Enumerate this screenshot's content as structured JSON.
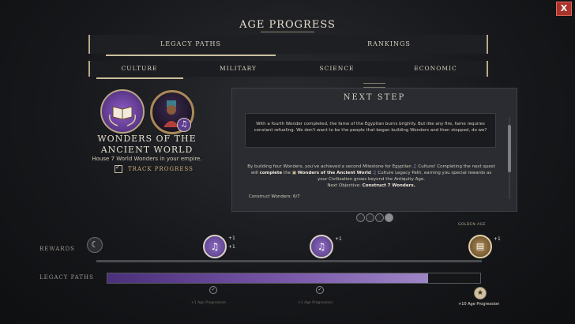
{
  "window": {
    "title": "AGE PROGRESS",
    "close_label": "X"
  },
  "top_tabs": [
    {
      "label": "LEGACY PATHS",
      "selected": true
    },
    {
      "label": "RANKINGS",
      "selected": false
    }
  ],
  "sub_tabs": [
    {
      "label": "CULTURE",
      "selected": true
    },
    {
      "label": "MILITARY",
      "selected": false
    },
    {
      "label": "SCIENCE",
      "selected": false
    },
    {
      "label": "ECONOMIC",
      "selected": false
    }
  ],
  "legacy_path": {
    "name": "WONDERS OF THE ANCIENT WORLD",
    "description": "House 7 World Wonders in your empire.",
    "track_label": "TRACK PROGRESS",
    "tracking": true,
    "icons": [
      "book-laurel-icon",
      "leader-portrait",
      "music-note-icon"
    ]
  },
  "next_step": {
    "heading": "NEXT STEP",
    "quote": "With a fourth Wonder completed, the fame of the Egyptian burns brightly. But like any fire, fame requires constant refueling. We don't want to be the people that began building Wonders and then stopped, do we?",
    "body_1": "By building four Wonders, you've achieved a second Milestone for Egyptian",
    "body_1b": "Culture! Completing the next quest will",
    "complete_word": "complete",
    "body_1c": "the",
    "path_name": "Wonders of the Ancient World",
    "body_1d": "Culture Legacy Path, earning you special rewards as your Civilization grows beyond the Antiquity Age.",
    "objective_prefix": "Next Objective:",
    "objective": "Construct 7 Wonders.",
    "progress_text": "Construct Wonders: 6/7"
  },
  "pager": {
    "pages": 4,
    "active": 4
  },
  "progress": {
    "rewards_label": "REWARDS",
    "legacy_label": "LEGACY PATHS",
    "fill_fraction": 0.86,
    "milestones": [
      {
        "bonus_1": "+1",
        "bonus_2": "+1",
        "age_progression": "+1 Age Progression",
        "done": true
      },
      {
        "bonus_1": "+1",
        "age_progression": "+1 Age Progression",
        "done": true
      },
      {
        "bonus_1": "+1",
        "label_above": "GOLDEN AGE",
        "age_progression": "+10 Age Progression",
        "done": false
      }
    ]
  },
  "colors": {
    "accent_purple": "#7856a8",
    "close_red": "#a8332a",
    "gold": "#c7b07a"
  }
}
